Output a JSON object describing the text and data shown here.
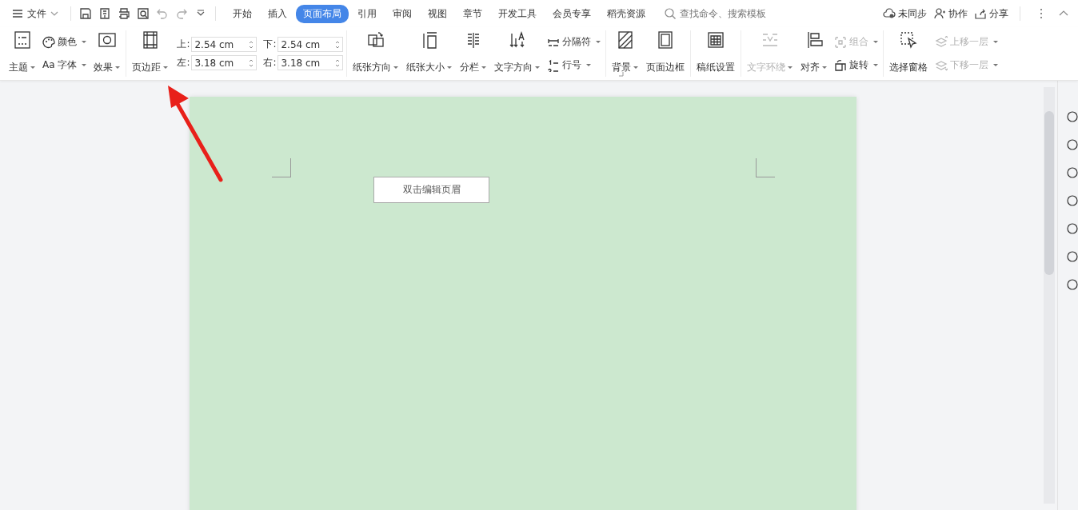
{
  "menu": {
    "label": "文件"
  },
  "tabs": [
    {
      "label": "开始",
      "selected": false
    },
    {
      "label": "插入",
      "selected": false
    },
    {
      "label": "页面布局",
      "selected": true
    },
    {
      "label": "引用",
      "selected": false
    },
    {
      "label": "审阅",
      "selected": false
    },
    {
      "label": "视图",
      "selected": false
    },
    {
      "label": "章节",
      "selected": false
    },
    {
      "label": "开发工具",
      "selected": false
    },
    {
      "label": "会员专享",
      "selected": false
    },
    {
      "label": "稻壳资源",
      "selected": false
    }
  ],
  "search": {
    "placeholder": "查找命令、搜索模板"
  },
  "actions": [
    {
      "label": "未同步"
    },
    {
      "label": "协作"
    },
    {
      "label": "分享"
    }
  ],
  "large_buttons": [
    {
      "label": "主题",
      "dropdown": true,
      "disabled": false
    },
    {
      "label": "效果",
      "dropdown": true,
      "disabled": false
    },
    {
      "label": "页边距",
      "dropdown": true,
      "disabled": false
    },
    {
      "label": "纸张方向",
      "dropdown": true,
      "disabled": false
    },
    {
      "label": "纸张大小",
      "dropdown": true,
      "disabled": false
    },
    {
      "label": "分栏",
      "dropdown": true,
      "disabled": false
    },
    {
      "label": "文字方向",
      "dropdown": true,
      "disabled": false
    },
    {
      "label": "背景",
      "dropdown": true,
      "disabled": false
    },
    {
      "label": "页面边框",
      "dropdown": false,
      "disabled": false
    },
    {
      "label": "稿纸设置",
      "dropdown": false,
      "disabled": false
    },
    {
      "label": "文字环绕",
      "dropdown": true,
      "disabled": true
    },
    {
      "label": "对齐",
      "dropdown": true,
      "disabled": false
    },
    {
      "label": "选择窗格",
      "dropdown": false,
      "disabled": false
    }
  ],
  "small_buttons": [
    {
      "label": "颜色",
      "dropdown": true,
      "disabled": false
    },
    {
      "label": "分隔符",
      "dropdown": true,
      "disabled": false
    },
    {
      "label": "组合",
      "dropdown": true,
      "disabled": true
    },
    {
      "label": "上移一层",
      "dropdown": true,
      "disabled": true
    },
    {
      "label": "Aa 字体",
      "dropdown": true,
      "disabled": false
    },
    {
      "label": "行号",
      "dropdown": true,
      "disabled": false
    },
    {
      "label": "旋转",
      "dropdown": true,
      "disabled": false
    },
    {
      "label": "下移一层",
      "dropdown": true,
      "disabled": true
    }
  ],
  "margins": [
    {
      "label": "上:",
      "value": "2.54 cm"
    },
    {
      "label": "下:",
      "value": "2.54 cm"
    },
    {
      "label": "左:",
      "value": "3.18 cm"
    },
    {
      "label": "右:",
      "value": "3.18 cm"
    }
  ],
  "document": {
    "header_hint": "双击编辑页眉"
  }
}
